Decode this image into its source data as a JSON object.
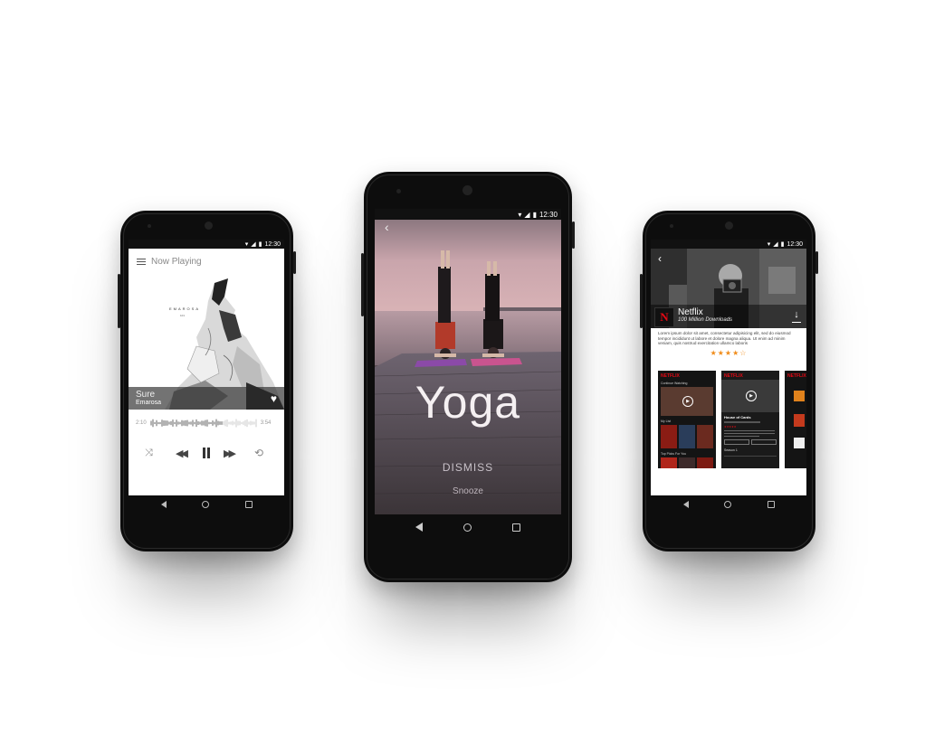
{
  "status": {
    "time": "12:30"
  },
  "music": {
    "header_title": "Now Playing",
    "album_art_text": "EMAROSA",
    "album_art_sub": "101",
    "track_title": "Sure",
    "track_artist": "Emarosa",
    "time_elapsed": "2:10",
    "time_total": "3:54"
  },
  "yoga": {
    "title": "Yoga",
    "dismiss_label": "DISMISS",
    "snooze_label": "Snooze"
  },
  "netflix": {
    "app_name": "Netflix",
    "downloads": "100 Million Downloads",
    "description": "Lorem ipsum dolor sit amet, consectetur adipisicing elit, sed do eiusmod tempor incididunt ut labore et dolore magna aliqua. Ut enim ad minim veniam, quis nostrud exercitation ullamco laboris",
    "rating_stars": 4.5,
    "screenshots": [
      {
        "brand": "NETFLIX",
        "row_label": "Continue Watching",
        "row2_label": "My List",
        "row3_label": "Top Picks For You"
      },
      {
        "brand": "NETFLIX",
        "show_title": "House of Cards",
        "season_label": "Season 1"
      },
      {
        "brand": "NETFLIX"
      }
    ]
  },
  "colors": {
    "netflix_red": "#e50914",
    "star_orange": "#f08c1a"
  }
}
